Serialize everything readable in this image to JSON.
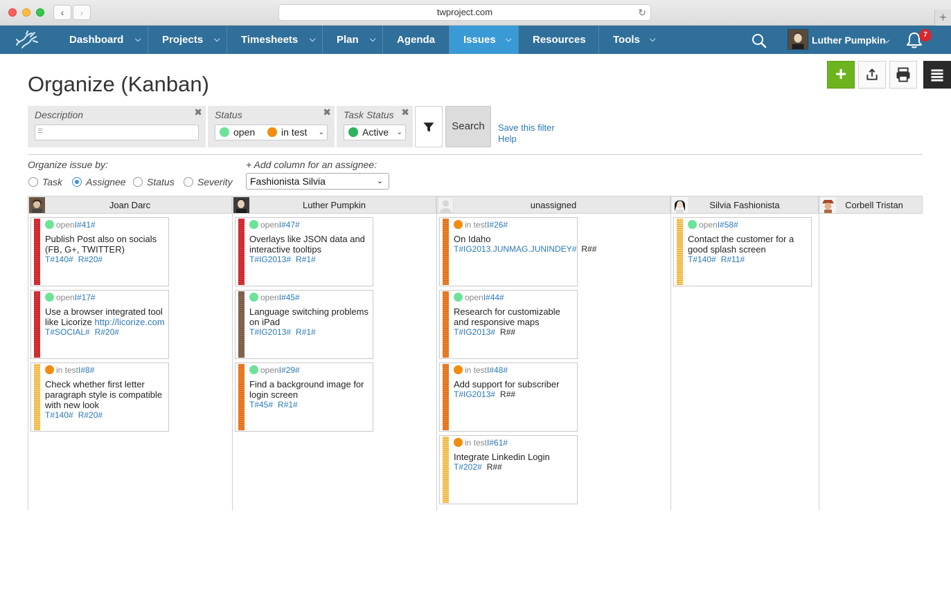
{
  "browser": {
    "url": "twproject.com"
  },
  "nav": {
    "items": [
      {
        "label": "Dashboard"
      },
      {
        "label": "Projects"
      },
      {
        "label": "Timesheets"
      },
      {
        "label": "Plan"
      },
      {
        "label": "Agenda"
      },
      {
        "label": "Issues"
      },
      {
        "label": "Resources"
      },
      {
        "label": "Tools"
      }
    ],
    "user_name": "Luther Pumpkin",
    "notifications": "7"
  },
  "page": {
    "title": "Organize (Kanban)"
  },
  "filter": {
    "description_label": "Description",
    "description_value": "",
    "status_label": "Status",
    "status_values": [
      "open",
      "in test"
    ],
    "task_status_label": "Task Status",
    "task_status_value": "Active",
    "search_label": "Search",
    "save_filter": "Save this filter",
    "help": "Help"
  },
  "organize": {
    "label": "Organize issue by:",
    "options": [
      "Task",
      "Assignee",
      "Status",
      "Severity"
    ],
    "selected": "Assignee",
    "add_column_label": "+ Add column for an assignee:",
    "add_column_value": "Fashionista Silvia"
  },
  "colors": {
    "nav_bg": "#2f6f9a",
    "nav_active": "#3a9ad6",
    "open": "#6de39a",
    "in_test": "#f28c0f",
    "active": "#2fb35f",
    "add_button": "#6db51f",
    "badge": "#d8262b"
  },
  "board": {
    "columns": [
      {
        "name": "Joan Darc"
      },
      {
        "name": "Luther Pumpkin"
      },
      {
        "name": "unassigned"
      },
      {
        "name": "Silvia Fashionista"
      },
      {
        "name": "Corbell Tristan"
      }
    ],
    "cards": [
      {
        "status": "open",
        "id": "I#41#",
        "title": "Publish Post also on socials (FB, G+, TWITTER)",
        "link": "",
        "task": "T#140#",
        "resource": "R#20#"
      },
      {
        "status": "open",
        "id": "I#17#",
        "title": "Use a browser integrated tool like Licorize ",
        "link": "http://licorize.com",
        "task": "T#SOCIAL#",
        "resource": "R#20#"
      },
      {
        "status": "in test",
        "id": "I#8#",
        "title": "Check whether first letter paragraph style is compatible with new look",
        "link": "",
        "task": "T#140#",
        "resource": "R#20#"
      },
      {
        "status": "open",
        "id": "I#47#",
        "title": "Overlays like JSON data and interactive tooltips",
        "link": "",
        "task": "T#IG2013#",
        "resource": "R#1#"
      },
      {
        "status": "open",
        "id": "I#45#",
        "title": "Language switching problems on iPad",
        "link": "",
        "task": "T#IG2013#",
        "resource": "R#1#"
      },
      {
        "status": "open",
        "id": "I#29#",
        "title": "Find a background image for login screen",
        "link": "",
        "task": "T#45#",
        "resource": "R#1#"
      },
      {
        "status": "in test",
        "id": "I#26#",
        "title": "On Idaho",
        "link": "",
        "task": "T#IG2013.JUNMAG.JUNINDEY#",
        "resource": "R##"
      },
      {
        "status": "open",
        "id": "I#44#",
        "title": "Research for customizable and responsive maps",
        "link": "",
        "task": "T#IG2013#",
        "resource": "R##"
      },
      {
        "status": "in test",
        "id": "I#48#",
        "title": "Add support for subscriber",
        "link": "",
        "task": "T#IG2013#",
        "resource": "R##"
      },
      {
        "status": "in test",
        "id": "I#61#",
        "title": "Integrate Linkedin Login",
        "link": "",
        "task": "T#202#",
        "resource": "R##"
      },
      {
        "status": "open",
        "id": "I#58#",
        "title": "Contact the customer for a good splash screen",
        "link": "",
        "task": "T#140#",
        "resource": "R#11#"
      }
    ]
  }
}
